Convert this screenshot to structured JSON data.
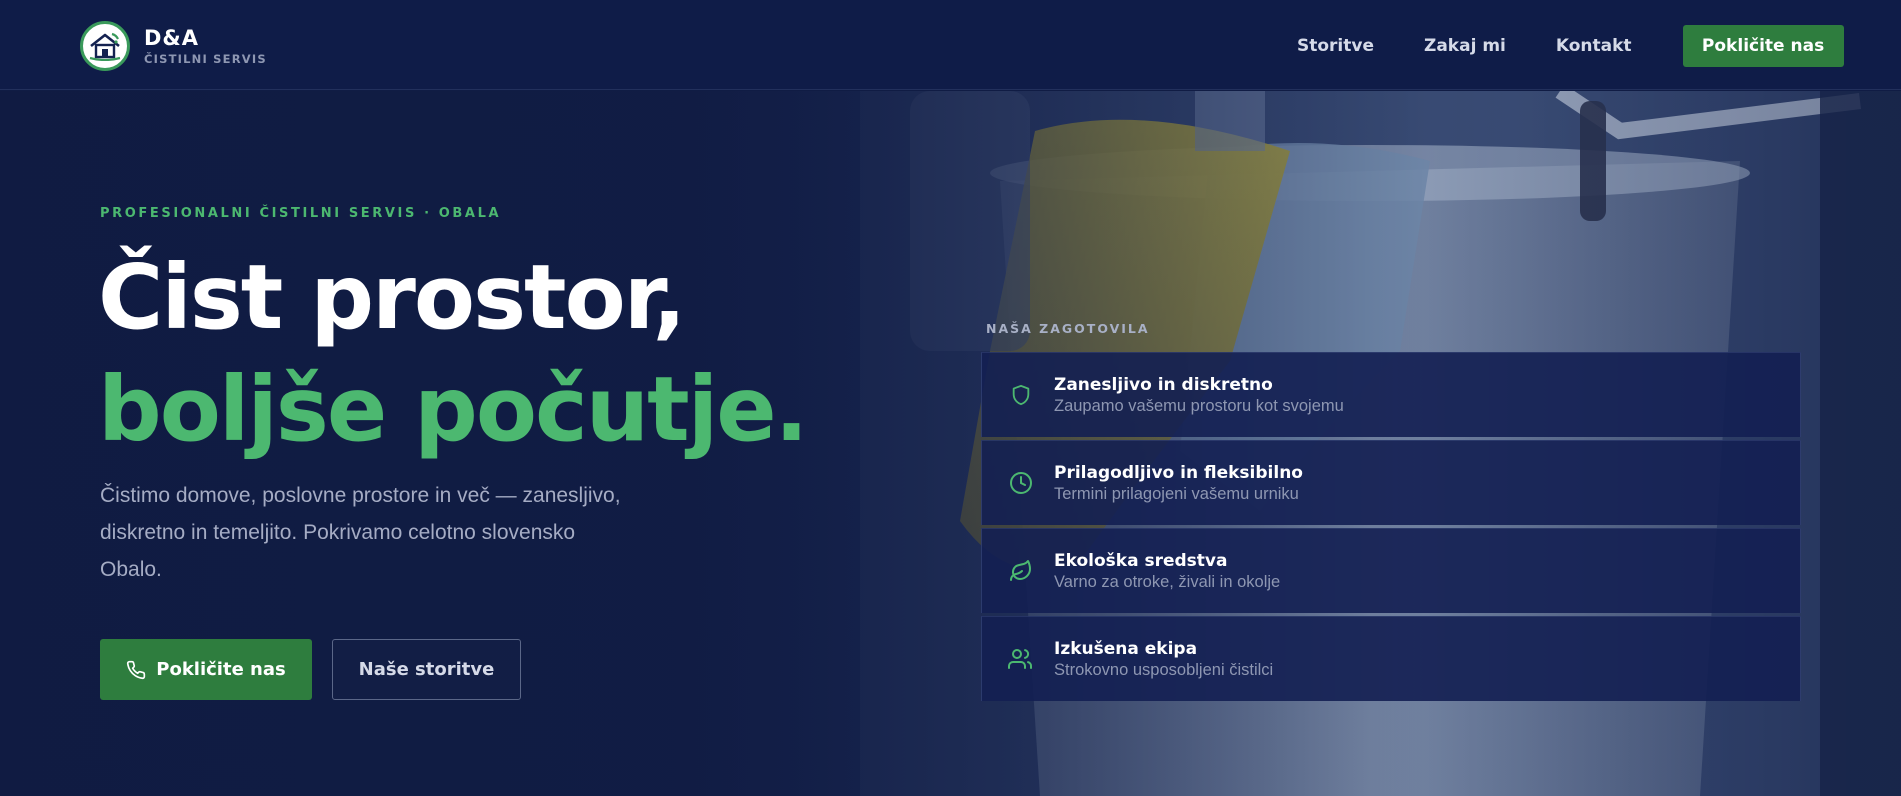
{
  "brand": {
    "title": "D&A",
    "subtitle": "ČISTILNI SERVIS",
    "logo_icon": "house-cleaning-logo-icon"
  },
  "nav": {
    "items": [
      {
        "label": "Storitve"
      },
      {
        "label": "Zakaj mi"
      },
      {
        "label": "Kontakt"
      }
    ],
    "cta_label": "Pokličite nas"
  },
  "hero": {
    "eyebrow": "PROFESIONALNI ČISTILNI SERVIS · OBALA",
    "headline_line1": "Čist prostor,",
    "headline_line2": "boljše počutje.",
    "lead": "Čistimo domove, poslovne prostore in več — zanesljivo, diskretno in temeljito. Pokrivamo celotno slovensko Obalo.",
    "primary_button": {
      "label": "Pokličite nas",
      "icon": "phone-icon"
    },
    "secondary_button": {
      "label": "Naše storitve"
    }
  },
  "guarantees": {
    "label": "NAŠA ZAGOTOVILA",
    "items": [
      {
        "title": "Zanesljivo in diskretno",
        "desc": "Zaupamo vašemu prostoru kot svojemu",
        "icon": "shield-icon"
      },
      {
        "title": "Prilagodljivo in fleksibilno",
        "desc": "Termini prilagojeni vašemu urniku",
        "icon": "clock-icon"
      },
      {
        "title": "Ekološka sredstva",
        "desc": "Varno za otroke, živali in okolje",
        "icon": "leaf-icon"
      },
      {
        "title": "Izkušena ekipa",
        "desc": "Strokovno usposobljeni čistilci",
        "icon": "users-icon"
      }
    ]
  },
  "colors": {
    "accent_green": "#4cb870",
    "button_green": "#2e7d3e",
    "navy": "#0f1c48"
  }
}
